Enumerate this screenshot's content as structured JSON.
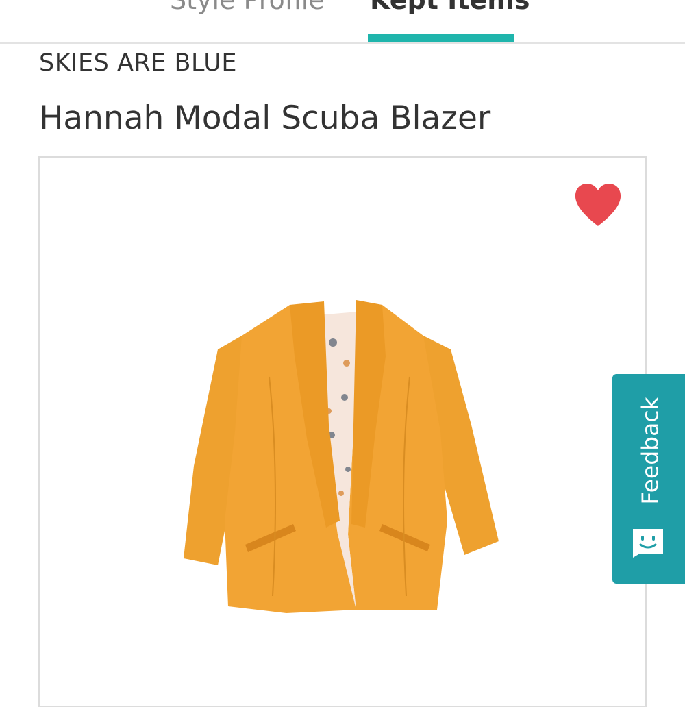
{
  "tabs": [
    {
      "label": "Style Profile",
      "active": false
    },
    {
      "label": "Kept Items",
      "active": true
    }
  ],
  "product": {
    "brand": "SKIES ARE BLUE",
    "name": "Hannah Modal Scuba Blazer",
    "favorited": true,
    "image_icon": "orange-blazer-image"
  },
  "feedback": {
    "label": "Feedback",
    "icon": "smiley-chat-icon"
  },
  "colors": {
    "accent": "#1fb5ac",
    "feedback_bg": "#1f9ea7",
    "heart": "#e8484f",
    "blazer": "#f0a02e"
  }
}
